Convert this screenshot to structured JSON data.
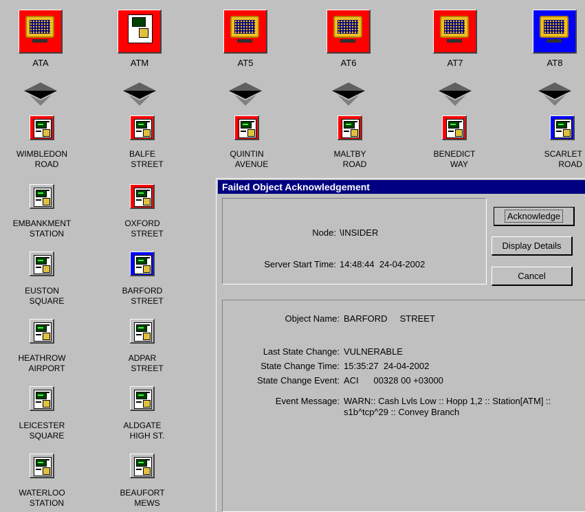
{
  "top_nodes": [
    {
      "label": "ATA",
      "color": "#ff0000"
    },
    {
      "label": "ATM",
      "color": "#ff0000"
    },
    {
      "label": "AT5",
      "color": "#ff0000"
    },
    {
      "label": "AT6",
      "color": "#ff0000"
    },
    {
      "label": "AT7",
      "color": "#ff0000"
    },
    {
      "label": "AT8",
      "color": "#0000ff"
    }
  ],
  "row_nodes": [
    {
      "line1": "WIMBLEDON",
      "line2": "ROAD",
      "color": "#ff0000"
    },
    {
      "line1": "BALFE",
      "line2": "STREET",
      "color": "#ff0000"
    },
    {
      "line1": "QUINTIN",
      "line2": "AVENUE",
      "color": "#ff0000"
    },
    {
      "line1": "MALTBY",
      "line2": "ROAD",
      "color": "#ff0000"
    },
    {
      "line1": "BENEDICT",
      "line2": "WAY",
      "color": "#ff0000"
    },
    {
      "line1": "SCARLET",
      "line2": "ROAD",
      "color": "#0000ff"
    }
  ],
  "col1_nodes": [
    {
      "line1": "EMBANKMENT",
      "line2": "STATION",
      "color": "#c0c0c0"
    },
    {
      "line1": "EUSTON",
      "line2": "SQUARE",
      "color": "#c0c0c0"
    },
    {
      "line1": "HEATHROW",
      "line2": "AIRPORT",
      "color": "#c0c0c0"
    },
    {
      "line1": "LEICESTER",
      "line2": "SQUARE",
      "color": "#c0c0c0"
    },
    {
      "line1": "WATERLOO",
      "line2": "STATION",
      "color": "#c0c0c0"
    }
  ],
  "col2_nodes": [
    {
      "line1": "OXFORD",
      "line2": "STREET",
      "color": "#ff0000"
    },
    {
      "line1": "BARFORD",
      "line2": "STREET",
      "color": "#0000ff"
    },
    {
      "line1": "ADPAR",
      "line2": "STREET",
      "color": "#c0c0c0"
    },
    {
      "line1": "ALDGATE",
      "line2": "HIGH ST.",
      "color": "#c0c0c0"
    },
    {
      "line1": "BEAUFORT",
      "line2": "MEWS",
      "color": "#c0c0c0"
    }
  ],
  "dialog": {
    "title": "Failed Object Acknowledgement",
    "node_label": "Node:",
    "node_value": "\\INSIDER",
    "server_start_label": "Server Start Time:",
    "server_start_value": "14:48:44  24-04-2002",
    "object_name_label": "Object Name:",
    "object_name_value": "BARFORD     STREET",
    "last_state_label": "Last State Change:",
    "last_state_value": "VULNERABLE",
    "state_time_label": "State Change Time:",
    "state_time_value": "15:35:27  24-04-2002",
    "state_event_label": "State Change Event:",
    "state_event_value": "ACI      00328 00 +03000",
    "event_msg_label": "Event Message:",
    "event_msg_line1": "WARN:: Cash Lvls Low :: Hopp 1,2 :: Station[ATM] ::",
    "event_msg_line2": "s1b^tcp^29 :: Convey Branch",
    "buttons": {
      "acknowledge": "Acknowledge",
      "display_details": "Display Details",
      "cancel": "Cancel"
    }
  }
}
